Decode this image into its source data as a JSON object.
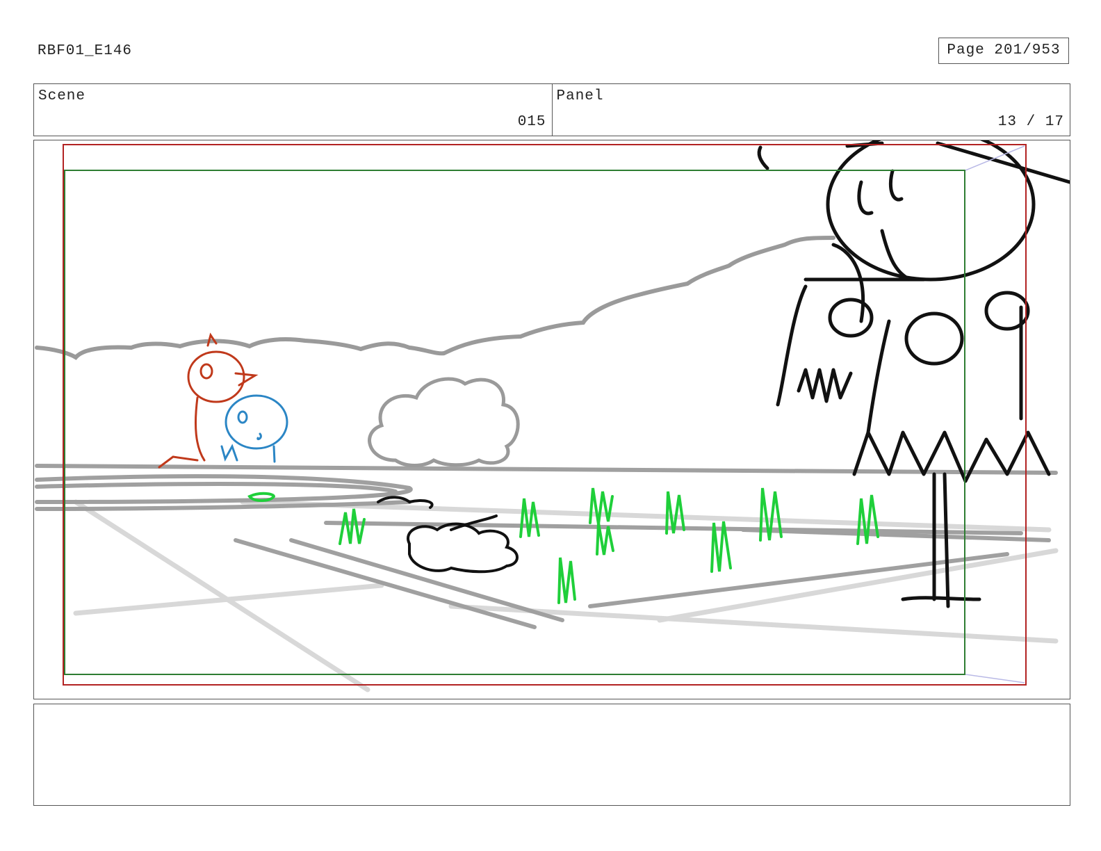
{
  "header": {
    "doc_id": "RBF01_E146",
    "page_label": "Page 201/953"
  },
  "info": {
    "scene_label": "Scene",
    "scene_value": "015",
    "panel_label": "Panel",
    "panel_value": "13 / 17"
  },
  "notes": {
    "text": ""
  },
  "colors": {
    "safe_frame": "#b22222",
    "title_safe": "#2e7d32",
    "ink": "#111111",
    "background_lines": "#999999",
    "grass": "#1fcf3a",
    "character_red": "#c0391b",
    "character_blue": "#2b86c5"
  }
}
